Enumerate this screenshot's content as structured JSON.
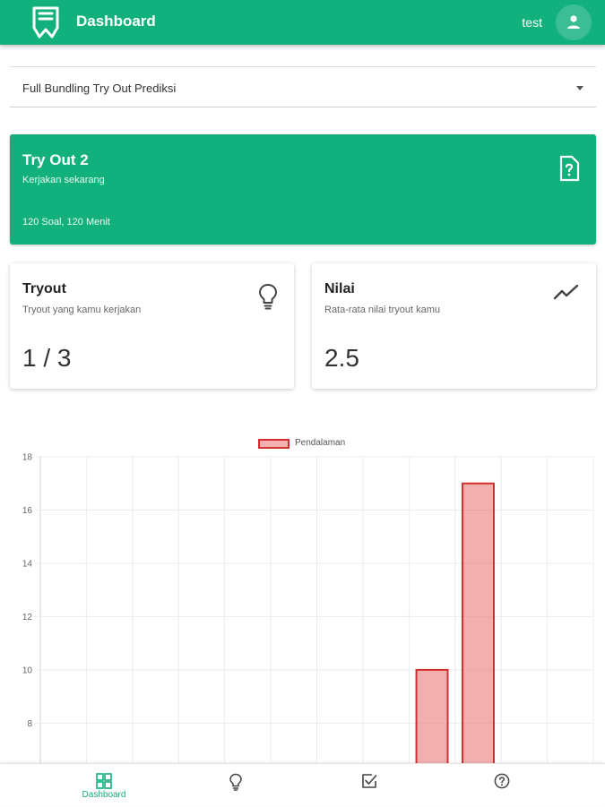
{
  "appbar": {
    "title": "Dashboard",
    "username": "test"
  },
  "select": {
    "value": "Full Bundling Try Out Prediksi"
  },
  "hero": {
    "title": "Try Out 2",
    "subtitle": "Kerjakan sekarang",
    "meta": "120 Soal, 120 Menit"
  },
  "stats": [
    {
      "title": "Tryout",
      "subtitle": "Tryout yang kamu kerjakan",
      "value": "1 / 3",
      "icon": "lightbulb-icon"
    },
    {
      "title": "Nilai",
      "subtitle": "Rata-rata nilai tryout kamu",
      "value": "2.5",
      "icon": "trending-up-icon"
    }
  ],
  "chart_data": {
    "type": "bar",
    "legend": "Pendalaman",
    "legend_position": "top",
    "grid": true,
    "colors": {
      "fill": "rgba(232,110,110,0.55)",
      "stroke": "#d32f2f"
    },
    "y_ticks": [
      "8",
      "10",
      "12",
      "14",
      "16",
      "18"
    ],
    "ylim_visible": [
      6.5,
      18
    ],
    "categories_count": 12,
    "series": [
      {
        "name": "Pendalaman",
        "values": [
          null,
          null,
          null,
          null,
          null,
          null,
          null,
          null,
          10,
          17,
          null,
          null
        ]
      }
    ]
  },
  "bottom_nav": {
    "items": [
      {
        "label": "Dashboard",
        "icon": "dashboard-icon",
        "active": true
      },
      {
        "label": "",
        "icon": "lightbulb-icon",
        "active": false
      },
      {
        "label": "",
        "icon": "checkbox-icon",
        "active": false
      },
      {
        "label": "",
        "icon": "help-icon",
        "active": false
      }
    ]
  },
  "colors": {
    "primary": "#12b07d"
  }
}
